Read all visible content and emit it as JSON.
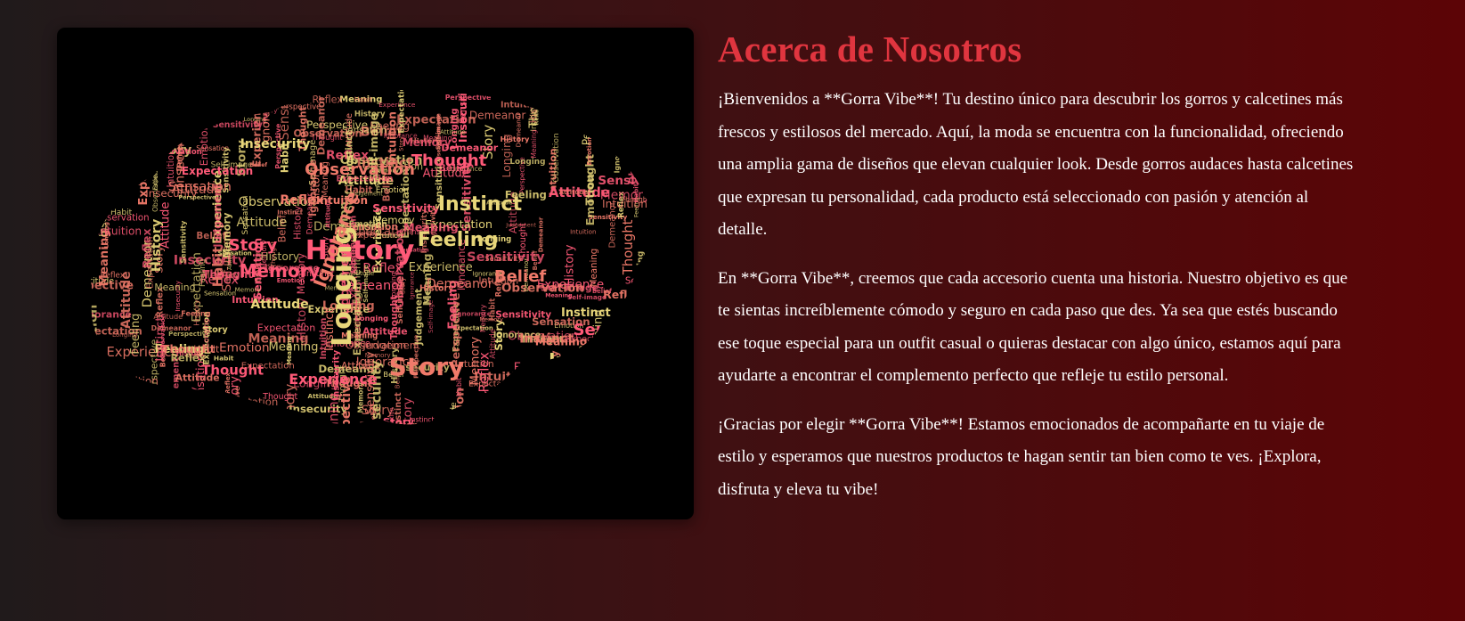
{
  "colors": {
    "title": "#e0353f",
    "text": "#ffffff",
    "word_pink": "#ff5a78",
    "word_yellow": "#e8d67a",
    "word_salmon": "#f07a6a"
  },
  "image": {
    "icon": "brain-word-cloud-image",
    "words": [
      "Judgement",
      "Habit",
      "Meaning",
      "Insecurity",
      "Observation",
      "Instinct",
      "Thought",
      "History",
      "Memory",
      "Feeling",
      "Ignorance",
      "Reflex",
      "Intuition",
      "Story",
      "Belief",
      "Longing",
      "Emotion",
      "Sensation",
      "Expectation",
      "Attitude",
      "Experience",
      "Self-image",
      "Perspective",
      "Sensitivity",
      "Demeanor"
    ]
  },
  "about": {
    "title": "Acerca de Nosotros",
    "paragraphs": [
      "¡Bienvenidos a **Gorra Vibe**! Tu destino único para descubrir los gorros y calcetines más frescos y estilosos del mercado. Aquí, la moda se encuentra con la funcionalidad, ofreciendo una amplia gama de diseños que elevan cualquier look. Desde gorros audaces hasta calcetines que expresan tu personalidad, cada producto está seleccionado con pasión y atención al detalle.",
      "En **Gorra Vibe**, creemos que cada accesorio cuenta una historia. Nuestro objetivo es que te sientas increíblemente cómodo y seguro en cada paso que des. Ya sea que estés buscando ese toque especial para un outfit casual o quieras destacar con algo único, estamos aquí para ayudarte a encontrar el complemento perfecto que refleje tu estilo personal.",
      "¡Gracias por elegir **Gorra Vibe**! Estamos emocionados de acompañarte en tu viaje de estilo y esperamos que nuestros productos te hagan sentir tan bien como te ves. ¡Explora, disfruta y eleva tu vibe!"
    ]
  }
}
